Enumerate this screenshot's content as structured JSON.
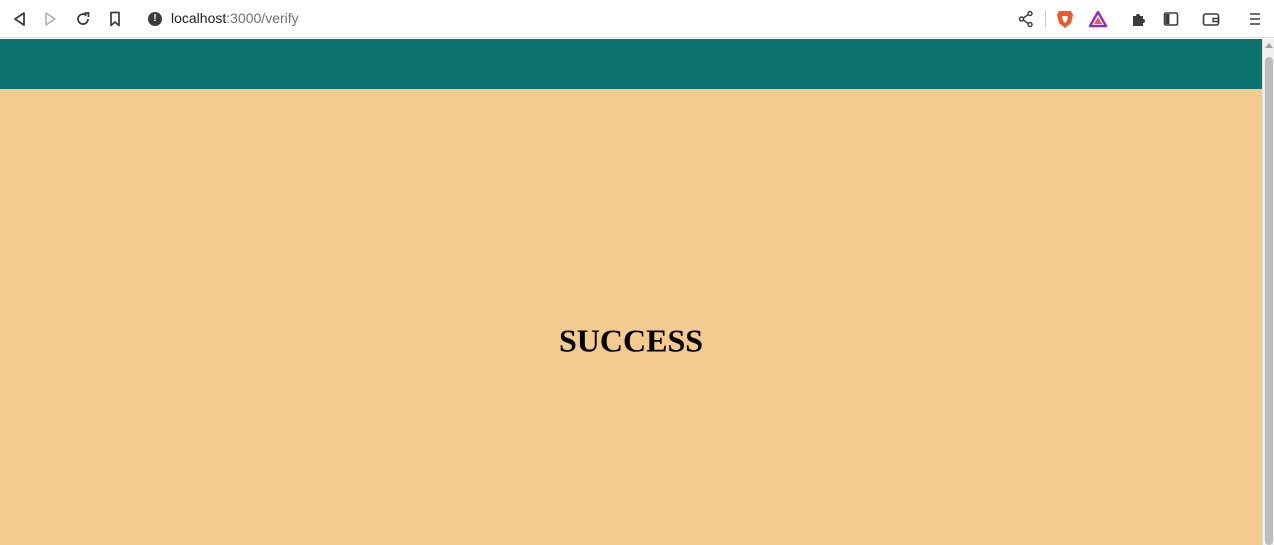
{
  "browser": {
    "url_host": "localhost",
    "url_path": ":3000/verify",
    "icons": {
      "back": "back-icon",
      "forward": "forward-icon",
      "reload": "reload-icon",
      "bookmark": "bookmark-icon",
      "site_info": "site-info-icon",
      "share": "share-icon",
      "brave_shields": "brave-shields-icon",
      "brave_rewards": "brave-rewards-icon",
      "extensions": "puzzle-icon",
      "sidebar": "sidebar-icon",
      "wallet": "wallet-icon",
      "menu": "hamburger-menu-icon"
    }
  },
  "page": {
    "header_color": "#0c7370",
    "background_color": "#f3cb8f",
    "message": "SUCCESS"
  }
}
